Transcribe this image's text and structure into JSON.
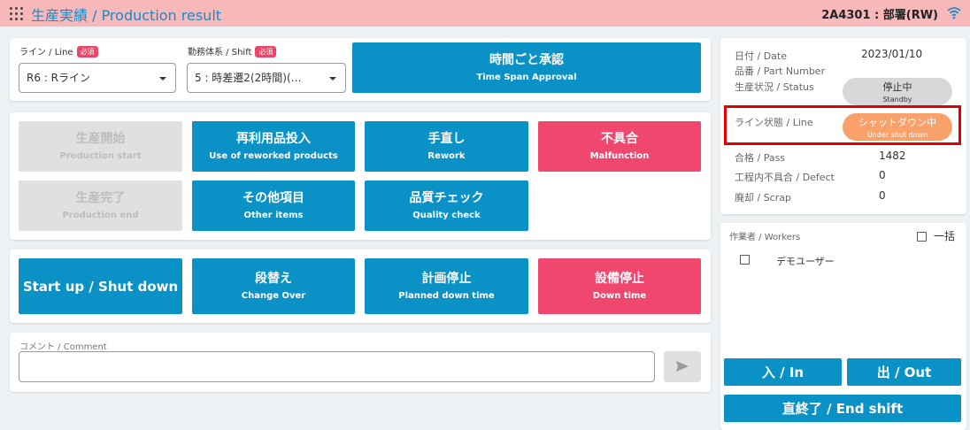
{
  "header": {
    "title": "生産実績 / Production result",
    "user": "2A4301 : 部署(RW)",
    "apps_icon": "apps-grid-icon",
    "wifi_icon": "wifi-icon"
  },
  "line_select": {
    "label": "ライン / Line",
    "required": "必須",
    "value": "R6 : Rライン"
  },
  "shift_select": {
    "label": "勤務体系 / Shift",
    "required": "必須",
    "value": "5 : 時差遷2(2時間)(…"
  },
  "approval_button": {
    "label": "時間ごと承認",
    "sub": "Time Span Approval"
  },
  "actions": {
    "production_start": {
      "label": "生産開始",
      "sub": "Production start"
    },
    "reworked_products": {
      "label": "再利用品投入",
      "sub": "Use of reworked products"
    },
    "rework": {
      "label": "手直し",
      "sub": "Rework"
    },
    "malfunction": {
      "label": "不具合",
      "sub": "Malfunction"
    },
    "production_end": {
      "label": "生産完了",
      "sub": "Production end"
    },
    "other_items": {
      "label": "その他項目",
      "sub": "Other items"
    },
    "quality_check": {
      "label": "品質チェック",
      "sub": "Quality check"
    }
  },
  "downtime": {
    "startup": {
      "label": "Start up / Shut down"
    },
    "changeover": {
      "label": "段替え",
      "sub": "Change Over"
    },
    "planned_down": {
      "label": "計画停止",
      "sub": "Planned down time"
    },
    "down_time": {
      "label": "設備停止",
      "sub": "Down time"
    }
  },
  "comment": {
    "label": "コメント / Comment",
    "value": "",
    "send_icon": "send-icon"
  },
  "info": {
    "date_label": "日付 / Date",
    "date_value": "2023/01/10",
    "part_label": "品番 / Part Number",
    "part_value": "",
    "status_label": "生産状況 / Status",
    "status_pill": {
      "main": "停止中",
      "sub": "Standby"
    },
    "line_label": "ライン状態 / Line",
    "line_pill": {
      "main": "シャットダウン中",
      "sub": "Under shut down"
    },
    "pass_label": "合格 / Pass",
    "pass_value": "1482",
    "defect_label": "工程内不具合 / Defect",
    "defect_value": "0",
    "scrap_label": "廃却 / Scrap",
    "scrap_value": "0"
  },
  "workers": {
    "label": "作業者 / Workers",
    "bulk_label": "一括",
    "items": [
      {
        "name": "デモユーザー",
        "checked": false
      }
    ],
    "in_label": "入 / In",
    "out_label": "出 / Out",
    "end_shift_label": "直終了 / End shift"
  },
  "colors": {
    "header_bg": "#f7b8b9",
    "blue": "#0a92c7",
    "red": "#f0476e",
    "disabled": "#e0e0e0",
    "orange": "#f8a16a",
    "highlight": "#e00000"
  }
}
